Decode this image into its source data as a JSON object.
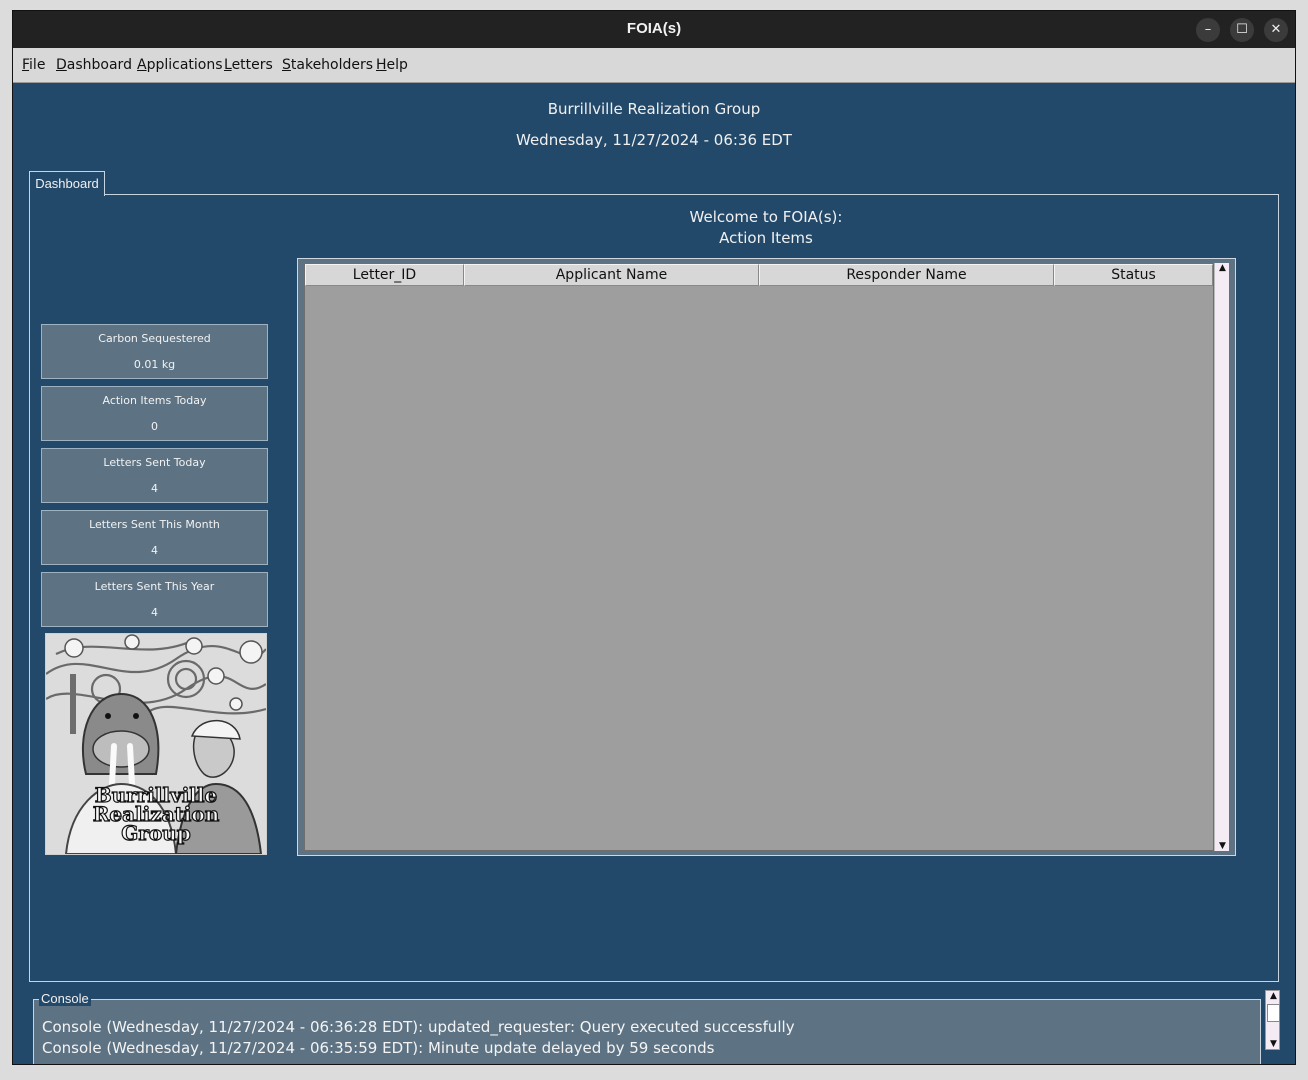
{
  "window": {
    "title": "FOIA(s)",
    "controls": {
      "minimize": "–",
      "maximize": "☐",
      "close": "✕"
    }
  },
  "menu": {
    "items": [
      "File",
      "Dashboard",
      "Applications",
      "Letters",
      "Stakeholders",
      "Help"
    ]
  },
  "header": {
    "organization": "Burrillville Realization Group",
    "datetime": "Wednesday, 11/27/2024  -  06:36 EDT"
  },
  "tabs": [
    {
      "label": "Dashboard"
    }
  ],
  "dashboard": {
    "welcome": "Welcome to FOIA(s):",
    "section_title": "Action Items",
    "stats": [
      {
        "label": "Carbon Sequestered",
        "value": "0.01 kg"
      },
      {
        "label": "Action Items Today",
        "value": "0"
      },
      {
        "label": "Letters Sent Today",
        "value": "4"
      },
      {
        "label": "Letters Sent This Month",
        "value": "4"
      },
      {
        "label": "Letters Sent This Year",
        "value": "4"
      }
    ],
    "logo_text": [
      "Burrillville",
      "Realization",
      "Group"
    ],
    "table": {
      "columns": [
        "Letter_ID",
        "Applicant Name",
        "Responder Name",
        "Status"
      ],
      "rows": []
    }
  },
  "console": {
    "label": "Console",
    "lines": [
      "Console (Wednesday, 11/27/2024  -  06:36:28 EDT): updated_requester: Query executed successfully",
      "Console (Wednesday, 11/27/2024  -  06:35:59 EDT): Minute update delayed by 59 seconds"
    ]
  },
  "colors": {
    "background": "#23496a",
    "card": "#5d7384",
    "table_bg": "#9d9e9d",
    "menubar": "#d8d8d8"
  }
}
